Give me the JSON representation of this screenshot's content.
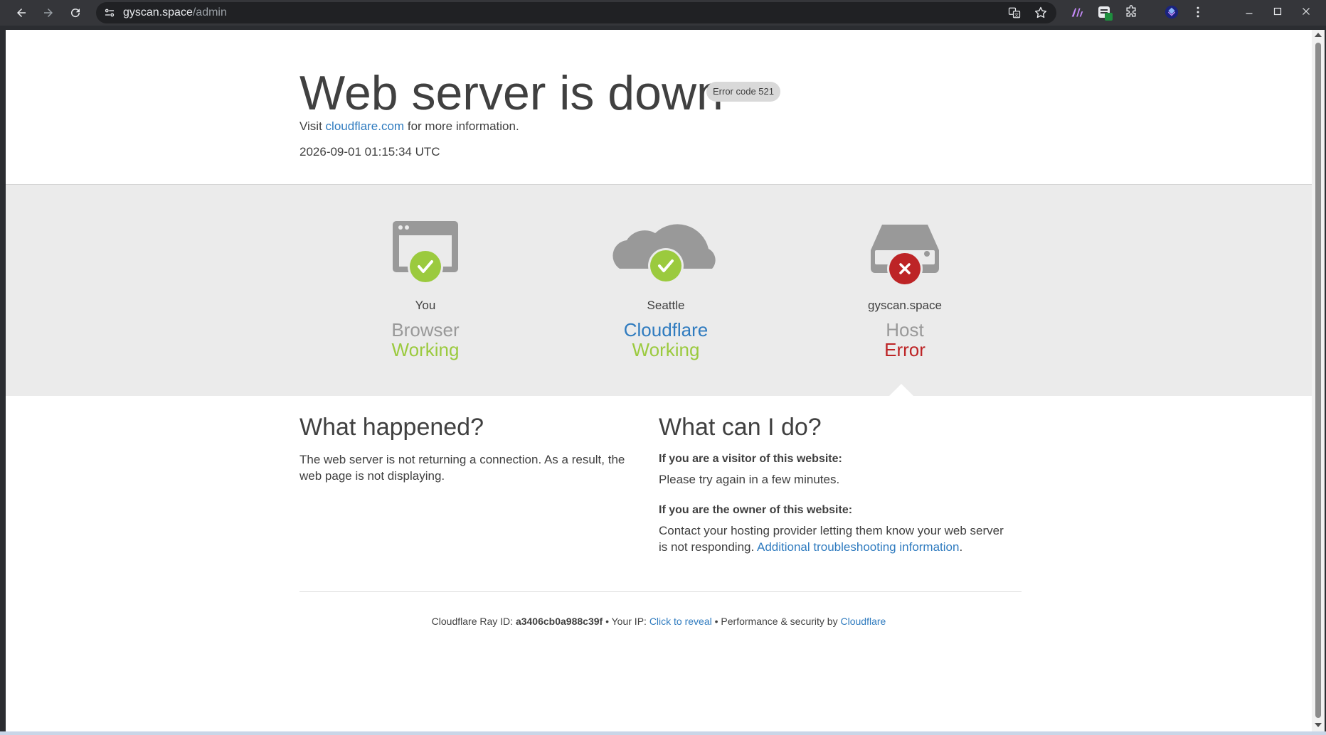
{
  "browser": {
    "url_host": "gyscan.space",
    "url_path": "/admin",
    "icons": [
      "back-icon",
      "forward-icon",
      "reload-icon",
      "site-info-icon",
      "translate-icon",
      "bookmark-star-icon",
      "extension-ai-icon",
      "extension-sheets-icon",
      "extensions-puzzle-icon",
      "profile-icon",
      "menu-kebab-icon",
      "minimize-icon",
      "maximize-icon",
      "close-icon"
    ]
  },
  "header": {
    "title": "Web server is down",
    "error_badge": "Error code 521",
    "visit_prefix": "Visit",
    "visit_link": "cloudflare.com",
    "visit_suffix": "for more information.",
    "timestamp": "2026-09-01 01:15:34 UTC"
  },
  "status": [
    {
      "location": "You",
      "label": "Browser",
      "state": "Working",
      "ok": true
    },
    {
      "location": "Seattle",
      "label": "Cloudflare",
      "state": "Working",
      "ok": true
    },
    {
      "location": "gyscan.space",
      "label": "Host",
      "state": "Error",
      "ok": false
    }
  ],
  "what_happened": {
    "heading": "What happened?",
    "text": "The web server is not returning a connection. As a result, the web page is not displaying."
  },
  "what_can_i_do": {
    "heading": "What can I do?",
    "visitor_heading": "If you are a visitor of this website:",
    "visitor_text": "Please try again in a few minutes.",
    "owner_heading": "If you are the owner of this website:",
    "owner_text": "Contact your hosting provider letting them know your web server is not responding.",
    "owner_link": "Additional troubleshooting information",
    "owner_end": "."
  },
  "footer": {
    "ray_label": "Cloudflare Ray ID:",
    "ray_id": "a3406cb0a988c39f",
    "ip_label": "Your IP:",
    "ip_link": "Click to reveal",
    "perf_label": "Performance & security by",
    "perf_link": "Cloudflare",
    "sep": "•"
  },
  "colors": {
    "ok": "#9bca3e",
    "error": "#bd2426",
    "link": "#2f7bbf",
    "icon_gray": "#999999"
  }
}
